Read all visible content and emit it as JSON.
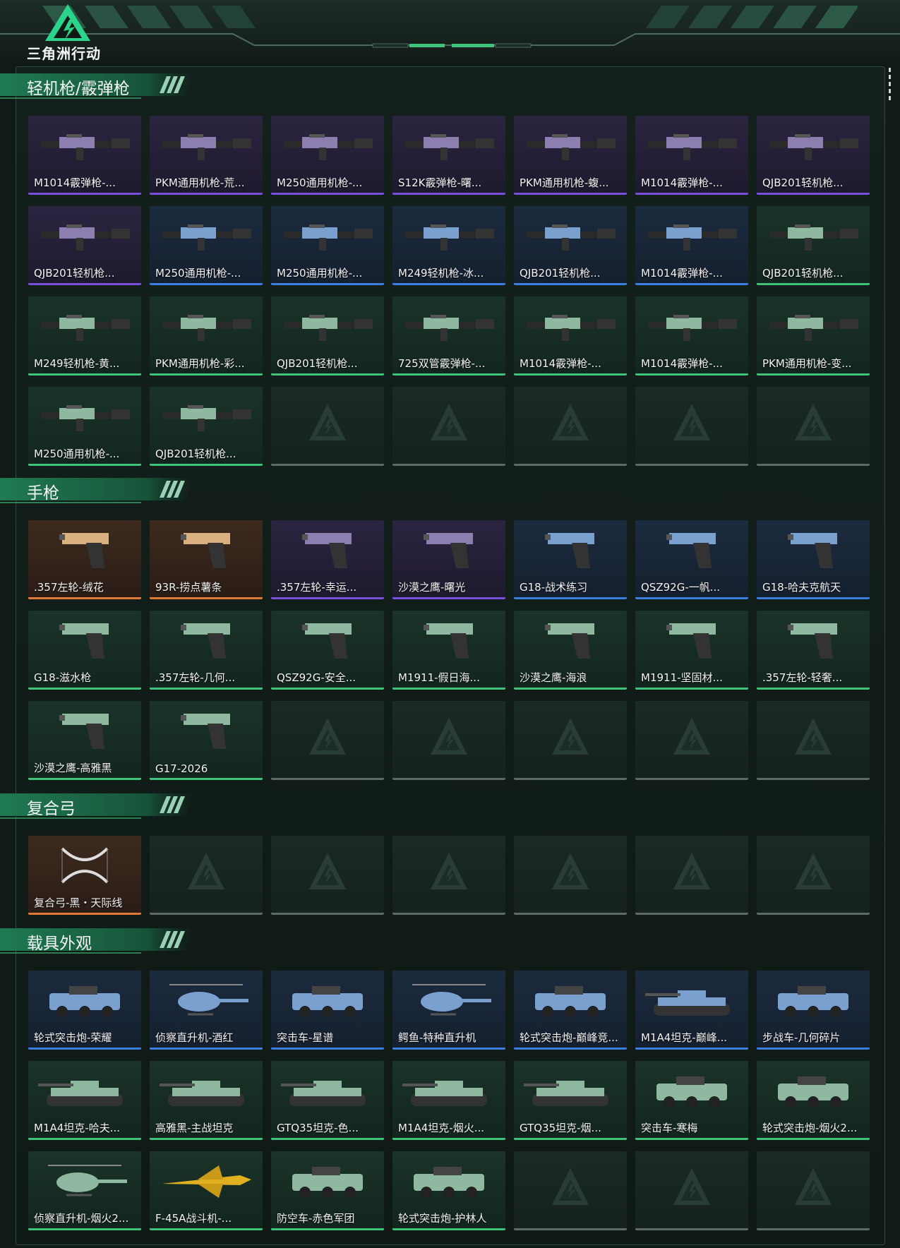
{
  "app": {
    "logo_text": "三角洲行动"
  },
  "colors": {
    "accent": "#3fc27a",
    "background": "#101a16",
    "rarity_purple": "#7a4fe0",
    "rarity_blue": "#3d7fe0",
    "rarity_green": "#3fc27a",
    "rarity_orange": "#e07a32",
    "empty": "#5d6a66"
  },
  "sections": [
    {
      "title": "轻机枪/霰弹枪",
      "items": [
        {
          "label": "M1014霰弹枪-...",
          "rarity": "purple",
          "kind": "gun"
        },
        {
          "label": "PKM通用机枪-荒...",
          "rarity": "purple",
          "kind": "gun"
        },
        {
          "label": "M250通用机枪-...",
          "rarity": "purple",
          "kind": "gun"
        },
        {
          "label": "S12K霰弹枪-曙...",
          "rarity": "purple",
          "kind": "gun"
        },
        {
          "label": "PKM通用机枪-蝮...",
          "rarity": "purple",
          "kind": "gun"
        },
        {
          "label": "M1014霰弹枪-...",
          "rarity": "purple",
          "kind": "gun"
        },
        {
          "label": "QJB201轻机枪...",
          "rarity": "purple",
          "kind": "gun"
        },
        {
          "label": "QJB201轻机枪...",
          "rarity": "purple",
          "kind": "gun"
        },
        {
          "label": "M250通用机枪-...",
          "rarity": "blue",
          "kind": "gun"
        },
        {
          "label": "M250通用机枪-...",
          "rarity": "blue",
          "kind": "gun"
        },
        {
          "label": "M249轻机枪-冰...",
          "rarity": "blue",
          "kind": "gun"
        },
        {
          "label": "QJB201轻机枪...",
          "rarity": "blue",
          "kind": "gun"
        },
        {
          "label": "M1014霰弹枪-...",
          "rarity": "blue",
          "kind": "gun"
        },
        {
          "label": "QJB201轻机枪...",
          "rarity": "green",
          "kind": "gun"
        },
        {
          "label": "M249轻机枪-黄...",
          "rarity": "green",
          "kind": "gun"
        },
        {
          "label": "PKM通用机枪-彩...",
          "rarity": "green",
          "kind": "gun"
        },
        {
          "label": "QJB201轻机枪...",
          "rarity": "green",
          "kind": "gun"
        },
        {
          "label": "725双管霰弹枪-...",
          "rarity": "green",
          "kind": "gun"
        },
        {
          "label": "M1014霰弹枪-...",
          "rarity": "green",
          "kind": "gun"
        },
        {
          "label": "M1014霰弹枪-...",
          "rarity": "green",
          "kind": "gun"
        },
        {
          "label": "PKM通用机枪-变...",
          "rarity": "green",
          "kind": "gun"
        },
        {
          "label": "M250通用机枪-...",
          "rarity": "green",
          "kind": "gun"
        },
        {
          "label": "QJB201轻机枪...",
          "rarity": "green",
          "kind": "gun"
        },
        {
          "label": "",
          "rarity": "empty"
        },
        {
          "label": "",
          "rarity": "empty"
        },
        {
          "label": "",
          "rarity": "empty"
        },
        {
          "label": "",
          "rarity": "empty"
        },
        {
          "label": "",
          "rarity": "empty"
        }
      ]
    },
    {
      "title": "手枪",
      "items": [
        {
          "label": ".357左轮-绒花",
          "rarity": "orange",
          "kind": "pistol"
        },
        {
          "label": "93R-捞点薯条",
          "rarity": "orange",
          "kind": "pistol"
        },
        {
          "label": ".357左轮-幸运...",
          "rarity": "purple",
          "kind": "pistol"
        },
        {
          "label": "沙漠之鹰-曙光",
          "rarity": "purple",
          "kind": "pistol"
        },
        {
          "label": "G18-战术练习",
          "rarity": "blue",
          "kind": "pistol"
        },
        {
          "label": "QSZ92G-一帆...",
          "rarity": "blue",
          "kind": "pistol"
        },
        {
          "label": "G18-哈夫克航天",
          "rarity": "blue",
          "kind": "pistol"
        },
        {
          "label": "G18-滋水枪",
          "rarity": "green",
          "kind": "pistol"
        },
        {
          "label": ".357左轮-几何...",
          "rarity": "green",
          "kind": "pistol"
        },
        {
          "label": "QSZ92G-安全...",
          "rarity": "green",
          "kind": "pistol"
        },
        {
          "label": "M1911-假日海...",
          "rarity": "green",
          "kind": "pistol"
        },
        {
          "label": "沙漠之鹰-海浪",
          "rarity": "green",
          "kind": "pistol"
        },
        {
          "label": "M1911-坚固材...",
          "rarity": "green",
          "kind": "pistol"
        },
        {
          "label": ".357左轮-轻奢...",
          "rarity": "green",
          "kind": "pistol"
        },
        {
          "label": "沙漠之鹰-高雅黑",
          "rarity": "green",
          "kind": "pistol"
        },
        {
          "label": "G17-2026",
          "rarity": "green",
          "kind": "pistol"
        },
        {
          "label": "",
          "rarity": "empty"
        },
        {
          "label": "",
          "rarity": "empty"
        },
        {
          "label": "",
          "rarity": "empty"
        },
        {
          "label": "",
          "rarity": "empty"
        },
        {
          "label": "",
          "rarity": "empty"
        }
      ]
    },
    {
      "title": "复合弓",
      "items": [
        {
          "label": "复合弓-黑・天际线",
          "rarity": "orange",
          "kind": "bow"
        },
        {
          "label": "",
          "rarity": "empty"
        },
        {
          "label": "",
          "rarity": "empty"
        },
        {
          "label": "",
          "rarity": "empty"
        },
        {
          "label": "",
          "rarity": "empty"
        },
        {
          "label": "",
          "rarity": "empty"
        },
        {
          "label": "",
          "rarity": "empty"
        }
      ]
    },
    {
      "title": "载具外观",
      "items": [
        {
          "label": "轮式突击炮-荣耀",
          "rarity": "blue",
          "kind": "vehicle"
        },
        {
          "label": "侦察直升机-酒红",
          "rarity": "blue",
          "kind": "heli"
        },
        {
          "label": "突击车-星谱",
          "rarity": "blue",
          "kind": "vehicle"
        },
        {
          "label": "鳄鱼-特种直升机",
          "rarity": "blue",
          "kind": "heli"
        },
        {
          "label": "轮式突击炮-巅峰竞...",
          "rarity": "blue",
          "kind": "vehicle"
        },
        {
          "label": "M1A4坦克-巅峰...",
          "rarity": "blue",
          "kind": "tank"
        },
        {
          "label": "步战车-几何碎片",
          "rarity": "blue",
          "kind": "vehicle"
        },
        {
          "label": "M1A4坦克-哈夫...",
          "rarity": "green",
          "kind": "tank"
        },
        {
          "label": "高雅黑-主战坦克",
          "rarity": "green",
          "kind": "tank"
        },
        {
          "label": "GTQ35坦克-色...",
          "rarity": "green",
          "kind": "tank"
        },
        {
          "label": "M1A4坦克-烟火...",
          "rarity": "green",
          "kind": "tank"
        },
        {
          "label": "GTQ35坦克-烟...",
          "rarity": "green",
          "kind": "tank"
        },
        {
          "label": "突击车-寒梅",
          "rarity": "green",
          "kind": "vehicle"
        },
        {
          "label": "轮式突击炮-烟火2...",
          "rarity": "green",
          "kind": "vehicle"
        },
        {
          "label": "侦察直升机-烟火2...",
          "rarity": "green",
          "kind": "heli"
        },
        {
          "label": "F-45A战斗机-...",
          "rarity": "green",
          "kind": "jet"
        },
        {
          "label": "防空车-赤色军团",
          "rarity": "green",
          "kind": "vehicle"
        },
        {
          "label": "轮式突击炮-护林人",
          "rarity": "green",
          "kind": "vehicle"
        },
        {
          "label": "",
          "rarity": "empty"
        },
        {
          "label": "",
          "rarity": "empty"
        },
        {
          "label": "",
          "rarity": "empty"
        }
      ]
    }
  ]
}
